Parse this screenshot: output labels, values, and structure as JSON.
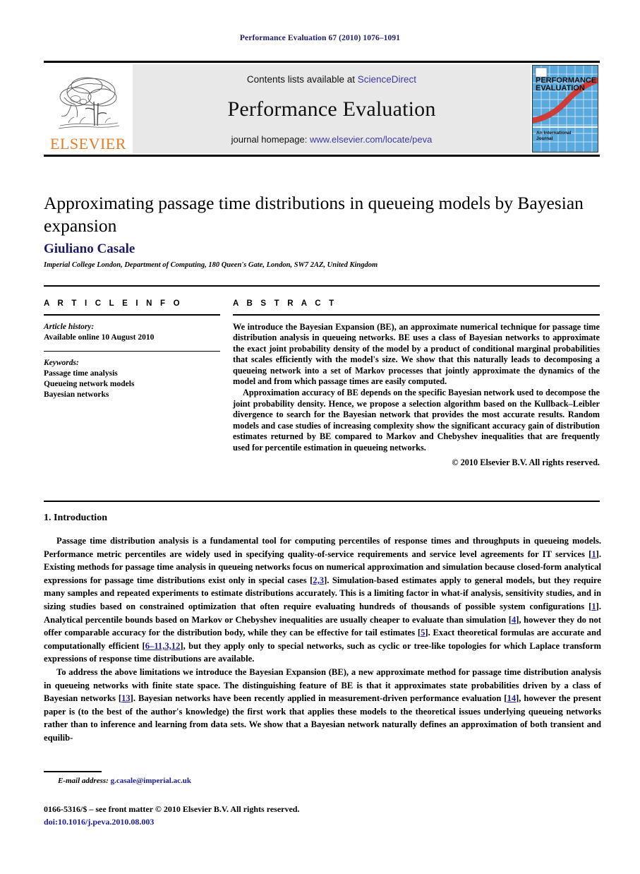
{
  "running_head": "Performance Evaluation 67 (2010) 1076–1091",
  "masthead": {
    "publisher_name": "ELSEVIER",
    "contents_prefix": "Contents lists available at",
    "contents_link": "ScienceDirect",
    "journal_title": "Performance Evaluation",
    "homepage_prefix": "journal homepage:",
    "homepage_link": "www.elsevier.com/locate/peva",
    "cover": {
      "title_line1": "PERFORMANCE",
      "title_line2": "EVALUATION",
      "subtitle_line1": "An International",
      "subtitle_line2": "Journal"
    },
    "link_color": "#3a39a8",
    "elsevier_orange": "#E77B22"
  },
  "article": {
    "title": "Approximating passage time distributions in queueing models by Bayesian expansion",
    "author": "Giuliano Casale",
    "affiliation": "Imperial College London, Department of Computing, 180 Queen's Gate, London, SW7 2AZ, United Kingdom",
    "author_color": "#1b1b6b"
  },
  "article_info": {
    "heading": "A R T I C L E   I N F O",
    "history_label": "Article history:",
    "history_value": "Available online 10 August 2010",
    "keywords_label": "Keywords:",
    "keywords": [
      "Passage time analysis",
      "Queueing network models",
      "Bayesian networks"
    ]
  },
  "abstract": {
    "heading": "A B S T R A C T",
    "paragraphs": [
      "We introduce the Bayesian Expansion (BE), an approximate numerical technique for passage time distribution analysis in queueing networks. BE uses a class of Bayesian networks to approximate the exact joint probability density of the model by a product of conditional marginal probabilities that scales efficiently with the model's size. We show that this naturally leads to decomposing a queueing network into a set of Markov processes that jointly approximate the dynamics of the model and from which passage times are easily computed.",
      "Approximation accuracy of BE depends on the specific Bayesian network used to decompose the joint probability density. Hence, we propose a selection algorithm based on the Kullback–Leibler divergence to search for the Bayesian network that provides the most accurate results. Random models and case studies of increasing complexity show the significant accuracy gain of distribution estimates returned by BE compared to Markov and Chebyshev inequalities that are frequently used for percentile estimation in queueing networks."
    ],
    "copyright": "© 2010 Elsevier B.V. All rights reserved."
  },
  "body": {
    "section_number_title": "1. Introduction",
    "paragraph1_a": "Passage time distribution analysis is a fundamental tool for computing percentiles of response times and throughputs in queueing models. Performance metric percentiles are widely used in specifying quality-of-service requirements and service level agreements for IT services [",
    "cite1": "1",
    "paragraph1_b": "]. Existing methods for passage time analysis in queueing networks focus on numerical approximation and simulation because closed-form analytical expressions for passage time distributions exist only in special cases [",
    "cite2": "2,3",
    "paragraph1_c": "]. Simulation-based estimates apply to general models, but they require many samples and repeated experiments to estimate distributions accurately. This is a limiting factor in what-if analysis, sensitivity studies, and in sizing studies based on constrained optimization that often require evaluating hundreds of thousands of possible system configurations [",
    "cite3": "1",
    "paragraph1_d": "]. Analytical percentile bounds based on Markov or Chebyshev inequalities are usually cheaper to evaluate than simulation [",
    "cite4": "4",
    "paragraph1_e": "], however they do not offer comparable accuracy for the distribution body, while they can be effective for tail estimates [",
    "cite5": "5",
    "paragraph1_f": "]. Exact theoretical formulas are accurate and computationally efficient [",
    "cite6": "6–11,3,12",
    "paragraph1_g": "], but they apply only to special networks, such as cyclic or tree-like topologies for which Laplace transform expressions of response time distributions are available.",
    "paragraph2_a": "To address the above limitations we introduce the Bayesian Expansion (BE), a new approximate method for passage time distribution analysis in queueing networks with finite state space. The distinguishing feature of BE is that it approximates state probabilities driven by a class of Bayesian networks [",
    "cite7": "13",
    "paragraph2_b": "]. Bayesian networks have been recently applied in measurement-driven performance evaluation [",
    "cite8": "14",
    "paragraph2_c": "], however the present paper is (to the best of the author's knowledge) the first work that applies these models to the theoretical issues underlying queueing networks rather than to inference and learning from data sets. We show that a Bayesian network naturally defines an approximation of both transient and equilib-"
  },
  "footer": {
    "email_label": "E-mail address:",
    "email_value": "g.casale@imperial.ac.uk",
    "issn_line": "0166-5316/$ – see front matter © 2010 Elsevier B.V. All rights reserved.",
    "doi_line": "doi:10.1016/j.peva.2010.08.003"
  }
}
